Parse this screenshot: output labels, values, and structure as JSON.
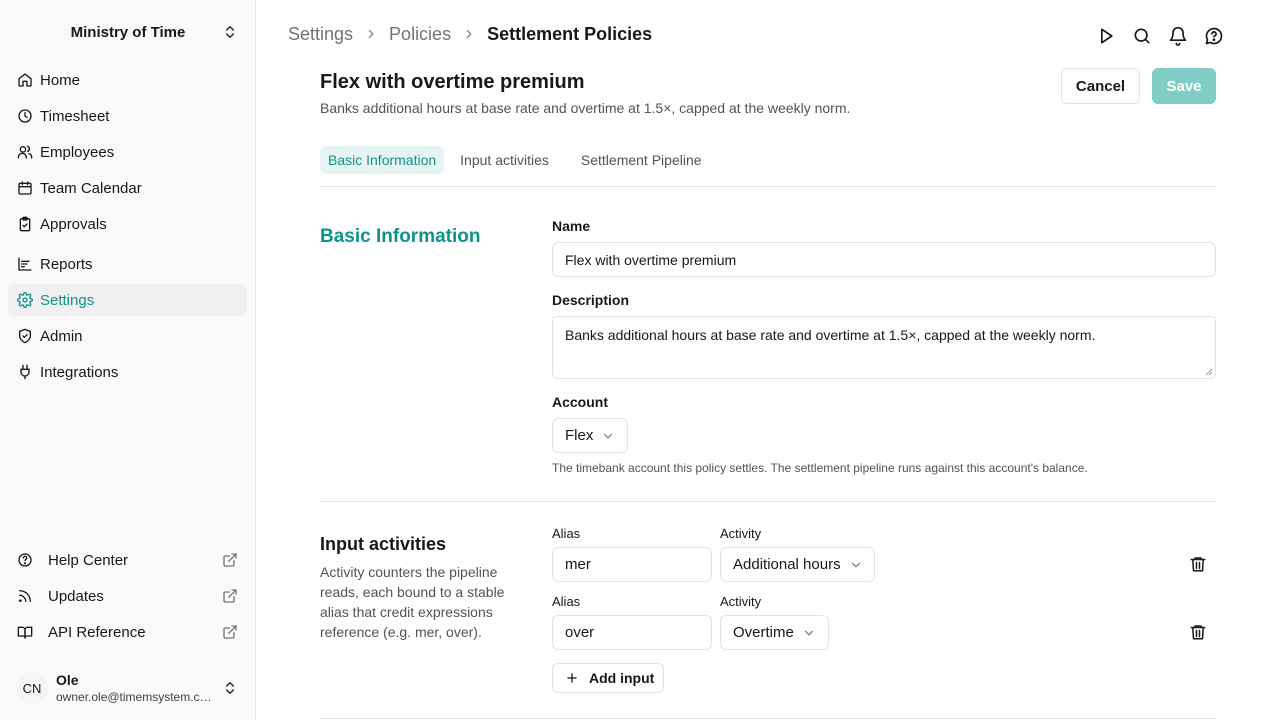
{
  "sidebar": {
    "org_name": "Ministry of Time",
    "nav": [
      {
        "label": "Home",
        "icon": "home-icon"
      },
      {
        "label": "Timesheet",
        "icon": "clock-icon"
      },
      {
        "label": "Employees",
        "icon": "users-icon"
      },
      {
        "label": "Team Calendar",
        "icon": "calendar-icon"
      },
      {
        "label": "Approvals",
        "icon": "clipboard-check-icon"
      },
      {
        "label": "Reports",
        "icon": "chart-icon"
      },
      {
        "label": "Settings",
        "icon": "gear-icon",
        "active": true
      },
      {
        "label": "Admin",
        "icon": "shield-icon"
      },
      {
        "label": "Integrations",
        "icon": "plug-icon"
      }
    ],
    "bottom": [
      {
        "label": "Help Center",
        "icon": "help-circle-icon"
      },
      {
        "label": "Updates",
        "icon": "rss-icon"
      },
      {
        "label": "API Reference",
        "icon": "book-icon"
      }
    ],
    "user": {
      "initials": "CN",
      "name": "Ole",
      "email": "owner.ole@timemsystem.com"
    }
  },
  "breadcrumb": [
    "Settings",
    "Policies",
    "Settlement Policies"
  ],
  "header": {
    "title": "Flex with overtime premium",
    "subtitle": "Banks additional hours at base rate and overtime at 1.5×, capped at the weekly norm.",
    "cancel_label": "Cancel",
    "save_label": "Save"
  },
  "tabs": [
    "Basic Information",
    "Input activities",
    "Settlement Pipeline"
  ],
  "basic": {
    "section_title": "Basic Information",
    "name_label": "Name",
    "name_value": "Flex with overtime premium",
    "description_label": "Description",
    "description_value": "Banks additional hours at base rate and overtime at 1.5×, capped at the weekly norm.",
    "account_label": "Account",
    "account_value": "Flex",
    "account_hint": "The timebank account this policy settles. The settlement pipeline runs against this account's balance."
  },
  "inputs": {
    "section_title": "Input activities",
    "section_desc": "Activity counters the pipeline reads, each bound to a stable alias that credit expressions reference (e.g. mer, over).",
    "alias_label": "Alias",
    "activity_label": "Activity",
    "rows": [
      {
        "alias": "mer",
        "activity": "Additional hours"
      },
      {
        "alias": "over",
        "activity": "Overtime"
      }
    ],
    "add_label": "Add input"
  }
}
